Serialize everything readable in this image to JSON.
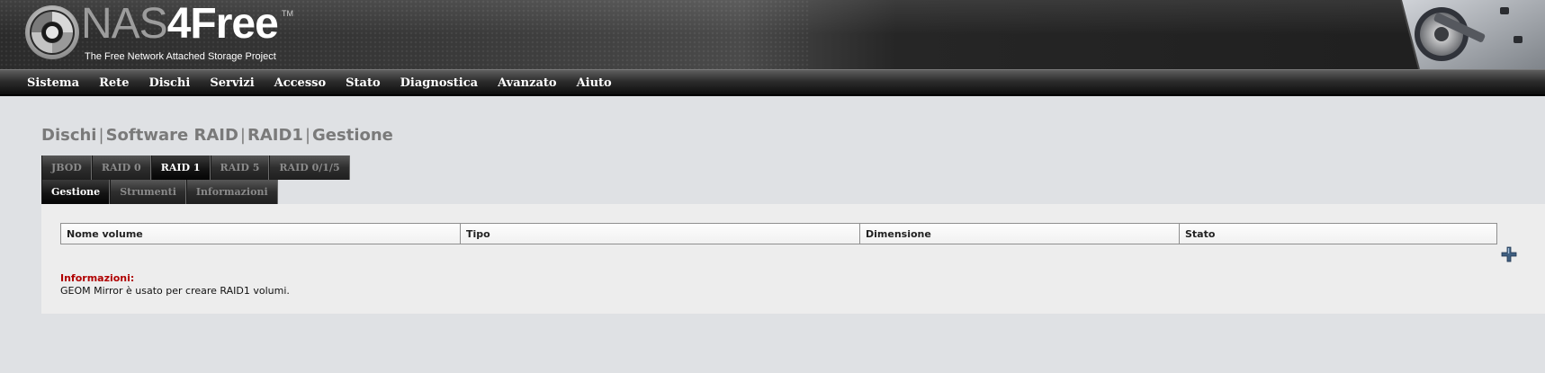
{
  "header": {
    "brand_prefix": "NAS",
    "brand_suffix": "4Free",
    "trademark": "TM",
    "subtitle": "The Free Network Attached Storage Project"
  },
  "mainnav": {
    "items": [
      {
        "label": "Sistema"
      },
      {
        "label": "Rete"
      },
      {
        "label": "Dischi"
      },
      {
        "label": "Servizi"
      },
      {
        "label": "Accesso"
      },
      {
        "label": "Stato"
      },
      {
        "label": "Diagnostica"
      },
      {
        "label": "Avanzato"
      },
      {
        "label": "Aiuto"
      }
    ]
  },
  "breadcrumb": {
    "parts": [
      "Dischi",
      "Software RAID",
      "RAID1",
      "Gestione"
    ],
    "separator": "|"
  },
  "tabs_primary": [
    {
      "label": "JBOD",
      "active": false
    },
    {
      "label": "RAID 0",
      "active": false
    },
    {
      "label": "RAID 1",
      "active": true
    },
    {
      "label": "RAID 5",
      "active": false
    },
    {
      "label": "RAID 0/1/5",
      "active": false
    }
  ],
  "tabs_secondary": [
    {
      "label": "Gestione",
      "active": true
    },
    {
      "label": "Strumenti",
      "active": false
    },
    {
      "label": "Informazioni",
      "active": false
    }
  ],
  "table": {
    "columns": [
      "Nome volume",
      "Tipo",
      "Dimensione",
      "Stato"
    ],
    "rows": []
  },
  "info": {
    "title": "Informazioni:",
    "text": "GEOM Mirror è usato per creare RAID1 volumi."
  },
  "icons": {
    "add": "plus-icon",
    "logo": "nas4free-logo-icon"
  },
  "colors": {
    "info_title": "#b00000",
    "page_background": "#dfe1e4",
    "panel_background": "#ededed"
  }
}
